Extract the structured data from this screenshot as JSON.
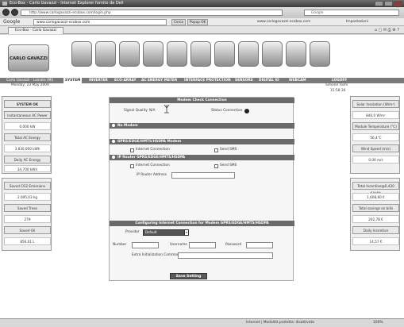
{
  "window": {
    "title": "Eco-Box - Carlo Gavazzi - Internet Explorer fornito da Dell"
  },
  "address": {
    "url": "http://www.carlogavazzi-ecobox.com/login.php",
    "search_placeholder": "Google"
  },
  "google_bar": {
    "label": "Google",
    "search_value": "www.carlogavazzi-ecobox.com",
    "search_btn": "Cerca",
    "popup_btn": "Popup OK",
    "link1": "www.carlogavazzi-ecobox.com",
    "settings": "Impostazioni"
  },
  "browser_tab": {
    "label": "Eco-Box - Carlo Gavazzi"
  },
  "brand": {
    "logo": "CARLO GAVAZZI"
  },
  "header_icons": [
    "house-icon",
    "signal-icon",
    "warning-icon",
    "globe-icon",
    "gear-icon",
    "check-icon",
    "sun-icon",
    "monitor-icon",
    "list-icon",
    "tools-icon",
    "flower-icon"
  ],
  "nav": {
    "location": "Carlo Gavazzi - Lainate (MI)",
    "items": [
      "SYSTEM",
      "INVERTER",
      "ECO-ARRAY",
      "AC ENERGY METER",
      "INTERFACE PROTECTION",
      "SENSORS",
      "DIGITAL IO",
      "WEBCAM",
      "LOGOFF"
    ]
  },
  "sub": {
    "date": "Monday, 23 May 2009",
    "user": "Simone Toshi",
    "time": "15:58:36"
  },
  "left": {
    "status": "SYSTEM OK",
    "ac_power_label": "Instantaneous AC Power",
    "ac_power_value": "0,000 kW",
    "total_ac_label": "Total AC Energy",
    "total_ac_value": "3.830,000 kWh",
    "daily_ac_label": "Daily AC Energy",
    "daily_ac_value": "34,700 kWh",
    "co2_label": "Saved CO2 Emissions",
    "co2_value": "2.695,03 kg",
    "trees_label": "Saved Trees",
    "trees_value": "279",
    "oil_label": "Saved Oil",
    "oil_value": "856,01 L"
  },
  "right": {
    "solar_label": "Solar Insolation (W/m²)",
    "solar_value": "840,0 W/m²",
    "module_label": "Module Temperature (°C)",
    "module_value": "56,4°C",
    "wind_label": "Wind Speed (m/s)",
    "wind_value": "0,00 m/s",
    "incentive_label": "Total Incentive@0,420 €/kWh",
    "incentive_value": "1.608,60 €",
    "bills_label": "Total savings on bills",
    "bills_value": "262,78 €",
    "daily_inc_label": "Daily Incentive",
    "daily_inc_value": "14,57 €"
  },
  "main": {
    "modem_check": "Modem Check Connection",
    "signal_label": "Signal Quality",
    "signal_value": "N/A",
    "status_label": "Status Connection",
    "no_modem": "No Modem",
    "gprs_modem": "GPRS/EDGE/HMTS/HSDPA Modem",
    "internet_conn": "Internet Connection",
    "send_sms": "Send SMS",
    "ip_router": "IP Router GPRS/EDGE/HMTS/HSDPA",
    "ip_internet": "Internet Connection",
    "ip_send_sms": "Send SMS",
    "ip_router_addr": "IP Router Address",
    "configuring": "Configuring Internet Connection for Modem GPRS/EDGE/HMTS/HSDPA",
    "provider_label": "Provider",
    "provider_value": "Default",
    "number_label": "Number",
    "username_label": "Username",
    "password_label": "Password",
    "extra_label": "Extra Initialization Commands",
    "save": "Save Setting"
  },
  "statusbar": {
    "text": "Internet | Modalità protetta: disattivata",
    "zoom": "100%"
  }
}
